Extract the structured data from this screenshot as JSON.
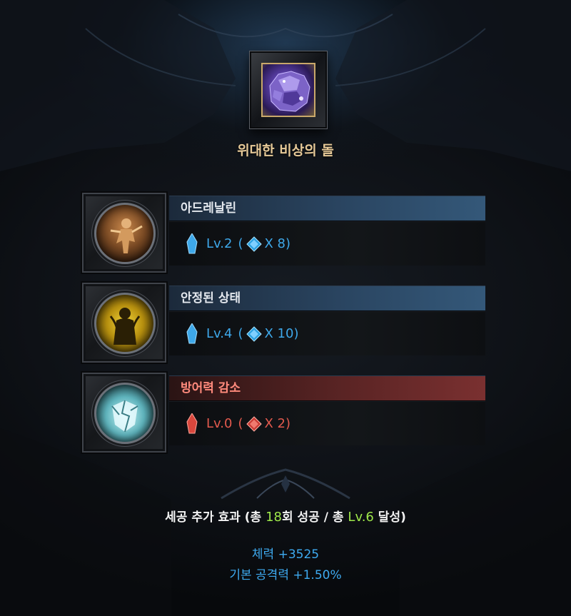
{
  "item": {
    "name": "위대한 비상의 돌",
    "icon": "purple-crystal-stone-icon"
  },
  "gems": [
    {
      "name": "아드레날린",
      "level": "Lv.2",
      "open_paren": "(",
      "count": "X 8)",
      "color": "blue",
      "icon": "adrenaline-figure-icon"
    },
    {
      "name": "안정된 상태",
      "level": "Lv.4",
      "open_paren": "(",
      "count": "X 10)",
      "color": "blue",
      "icon": "calm-silhouette-icon"
    },
    {
      "name": "방어력 감소",
      "level": "Lv.0",
      "open_paren": "(",
      "count": "X 2)",
      "color": "red",
      "icon": "shattered-shield-icon"
    }
  ],
  "bonus": {
    "title_prefix": "세공 추가 효과 (총 ",
    "success_count": "18",
    "title_mid": "회 성공 / 총 ",
    "total_level": "Lv.6",
    "title_suffix": " 달성)",
    "stats": [
      "체력 +3525",
      "기본 공격력 +1.50%"
    ]
  },
  "colors": {
    "blue_text": "#3ea8ea",
    "red_text": "#e35a4e",
    "gold_title": "#e6c998",
    "green_highlight": "#9ee84a"
  }
}
